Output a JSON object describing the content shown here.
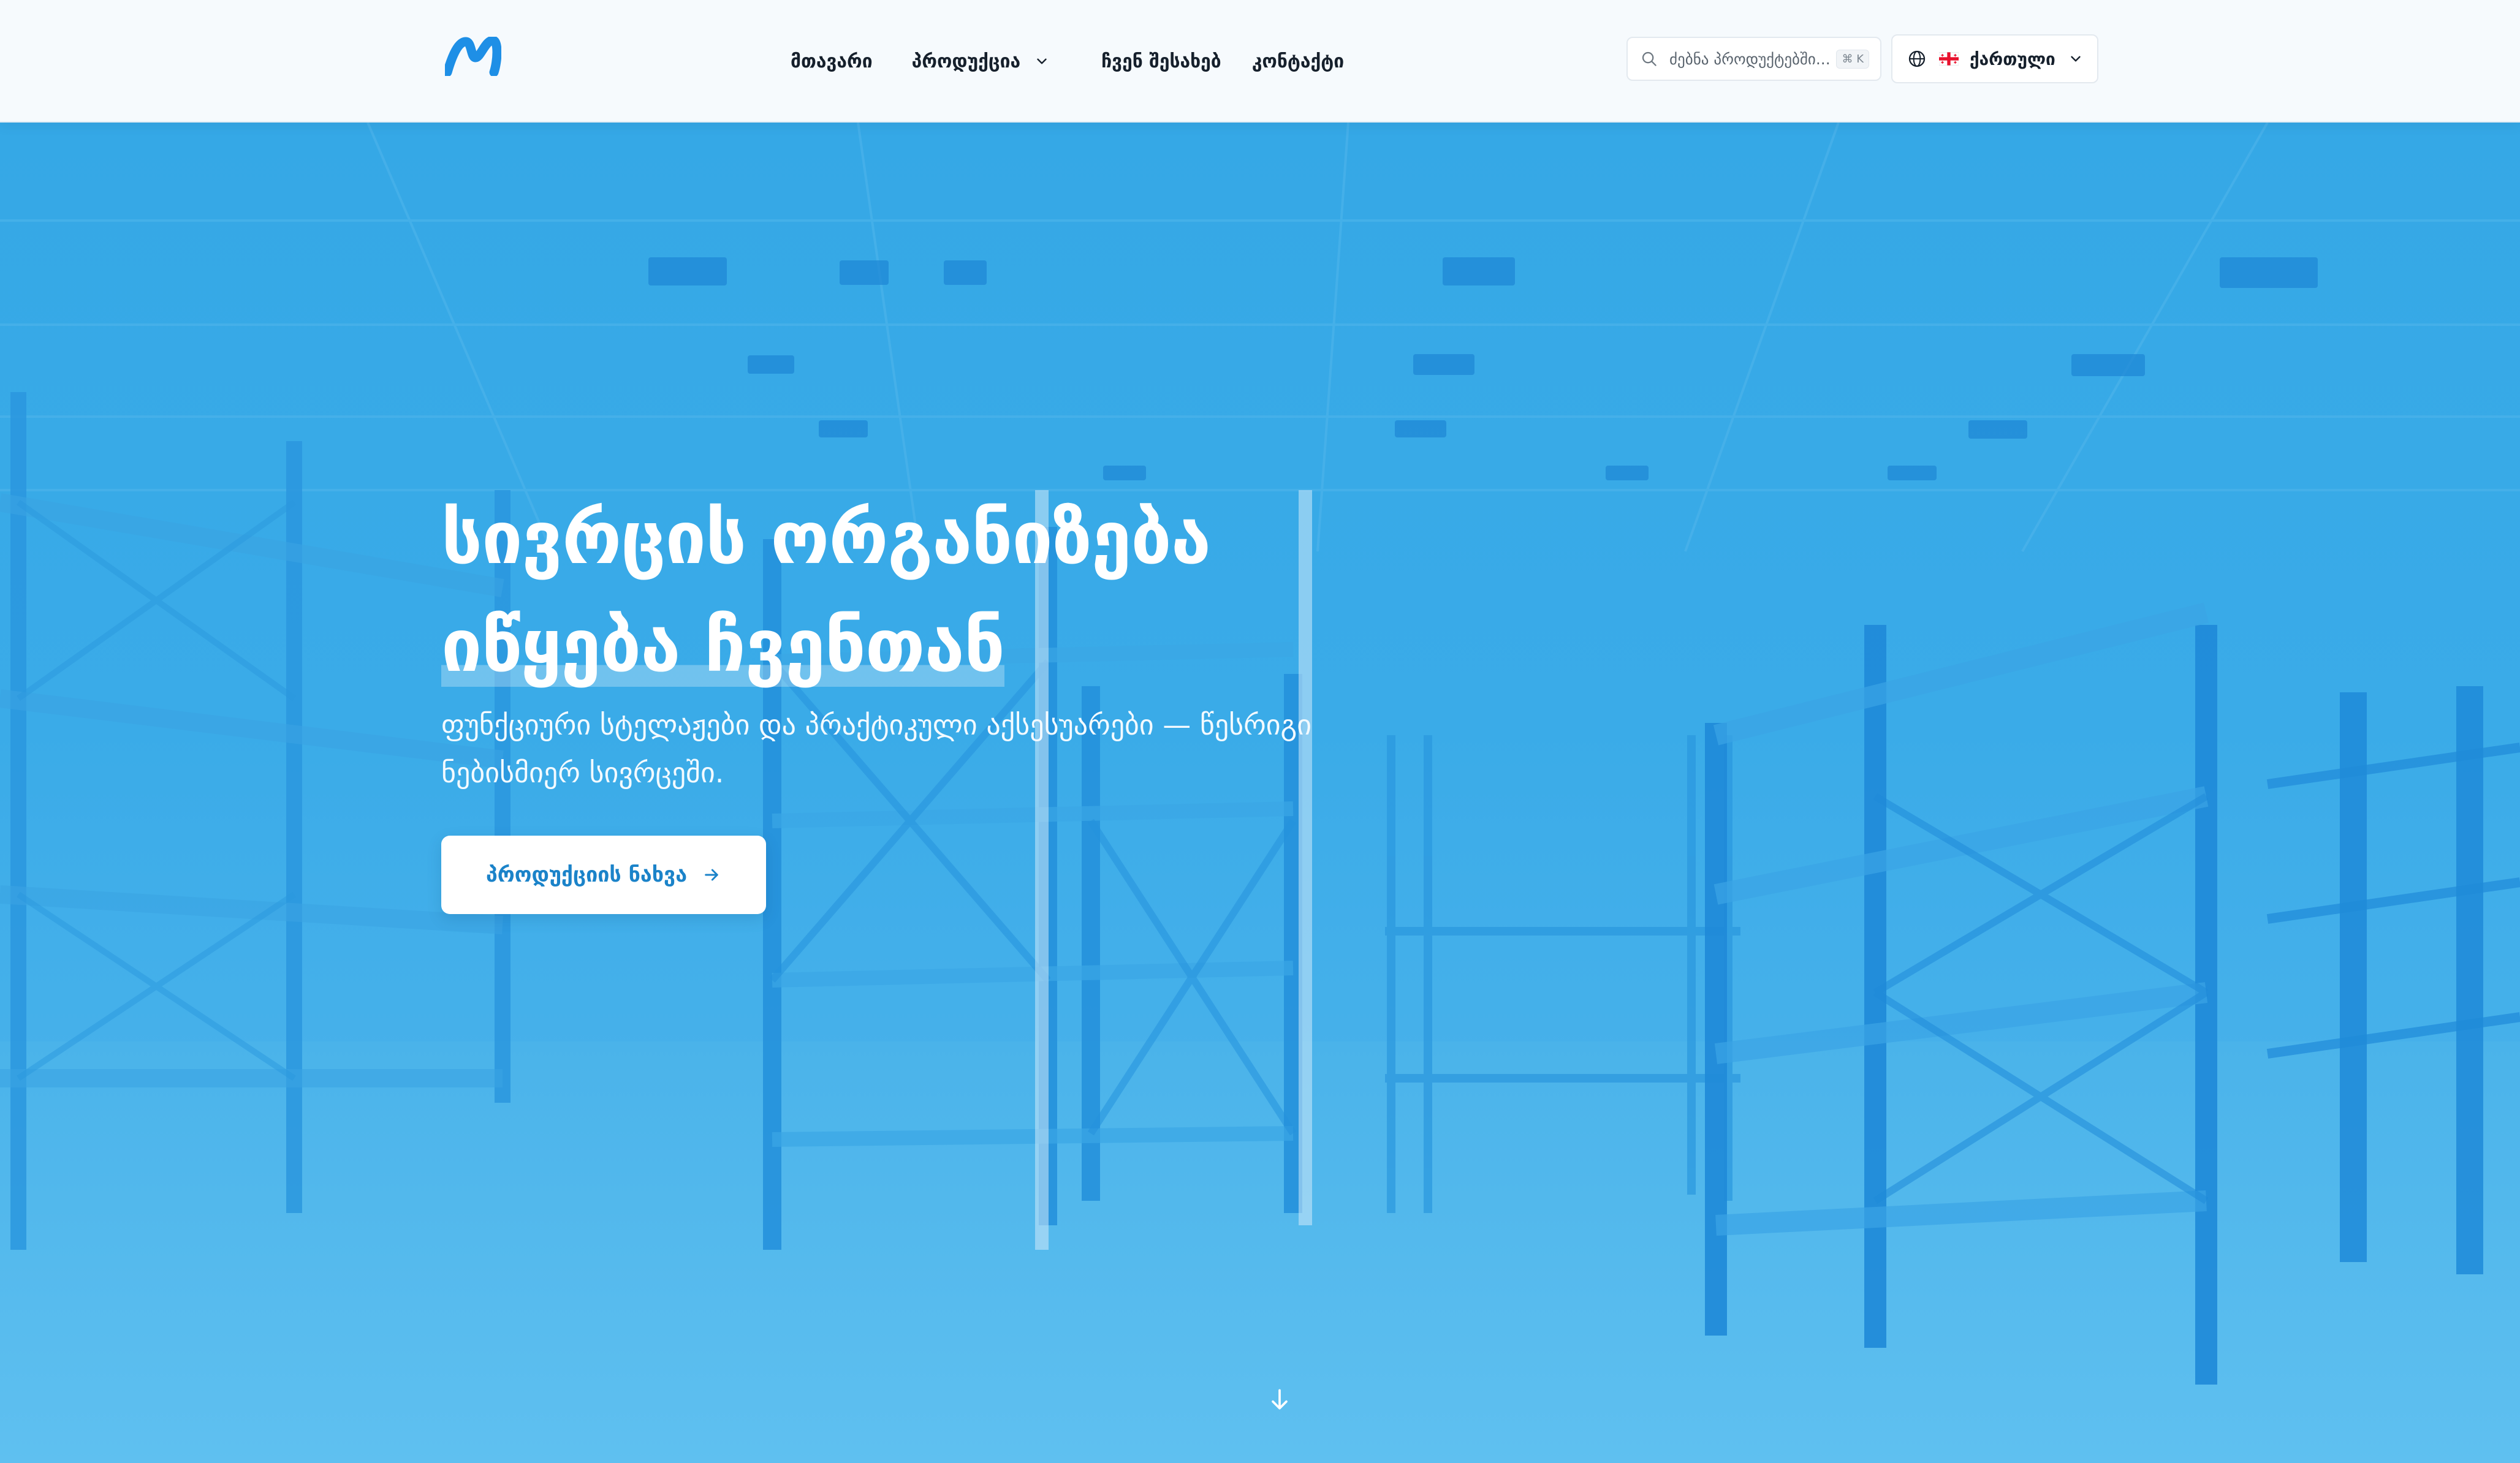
{
  "header": {
    "logo_icon": "brand-m-logo",
    "nav": [
      {
        "label": "მთავარი"
      },
      {
        "label": "პროდუქცია",
        "icon": "chevron-down-icon"
      },
      {
        "label": "ჩვენ შესახებ"
      },
      {
        "label": "კონტაქტი"
      }
    ],
    "search": {
      "placeholder": "ძებნა პროდუქტებში...",
      "shortcut": "⌘ K",
      "icon": "search-icon"
    },
    "language": {
      "label": "ქართული",
      "icon": "globe-icon",
      "flag": "georgia-flag-icon"
    }
  },
  "hero": {
    "title_line_1": "სივრცის ორგანიზება",
    "title_line_2": "იწყება ჩვენთან",
    "subtitle": "ფუნქციური სტელაჟები და პრაქტიკული აქსესუარები — წესრიგი ნებისმიერ სივრცეში.",
    "cta_label": "პროდუქციის ნახვა",
    "cta_icon": "arrow-right-icon",
    "scroll_icon": "arrow-down-icon"
  },
  "colors": {
    "brand": "#1e90e6",
    "hero_overlay": "#35a8e6",
    "cta_text": "#1b83c9"
  }
}
